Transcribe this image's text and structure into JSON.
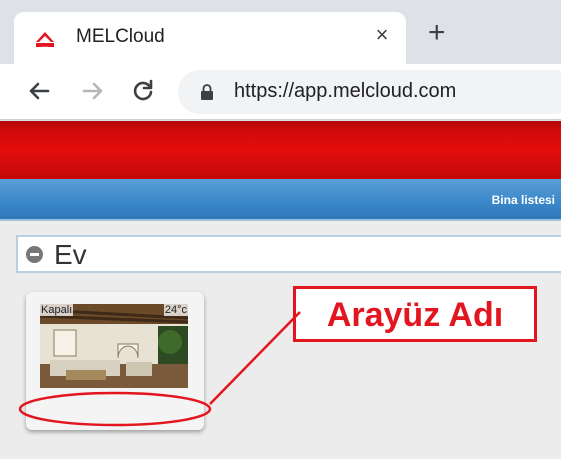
{
  "browser": {
    "tab_title": "MELCloud",
    "tab_close": "×",
    "new_tab": "+",
    "url": "https://app.melcloud.com"
  },
  "header": {
    "nav_link": "Bina listesi"
  },
  "building": {
    "name": "Ev"
  },
  "unit_card": {
    "status": "Kapalı",
    "temperature": "24°c",
    "name": ""
  },
  "annotation": {
    "label": "Arayüz Adı",
    "color": "#e3151e"
  },
  "icons": [
    "melcloud-favicon",
    "close-icon",
    "plus-icon",
    "back-arrow-icon",
    "forward-arrow-icon",
    "reload-icon",
    "lock-icon",
    "minus-circle-icon"
  ]
}
